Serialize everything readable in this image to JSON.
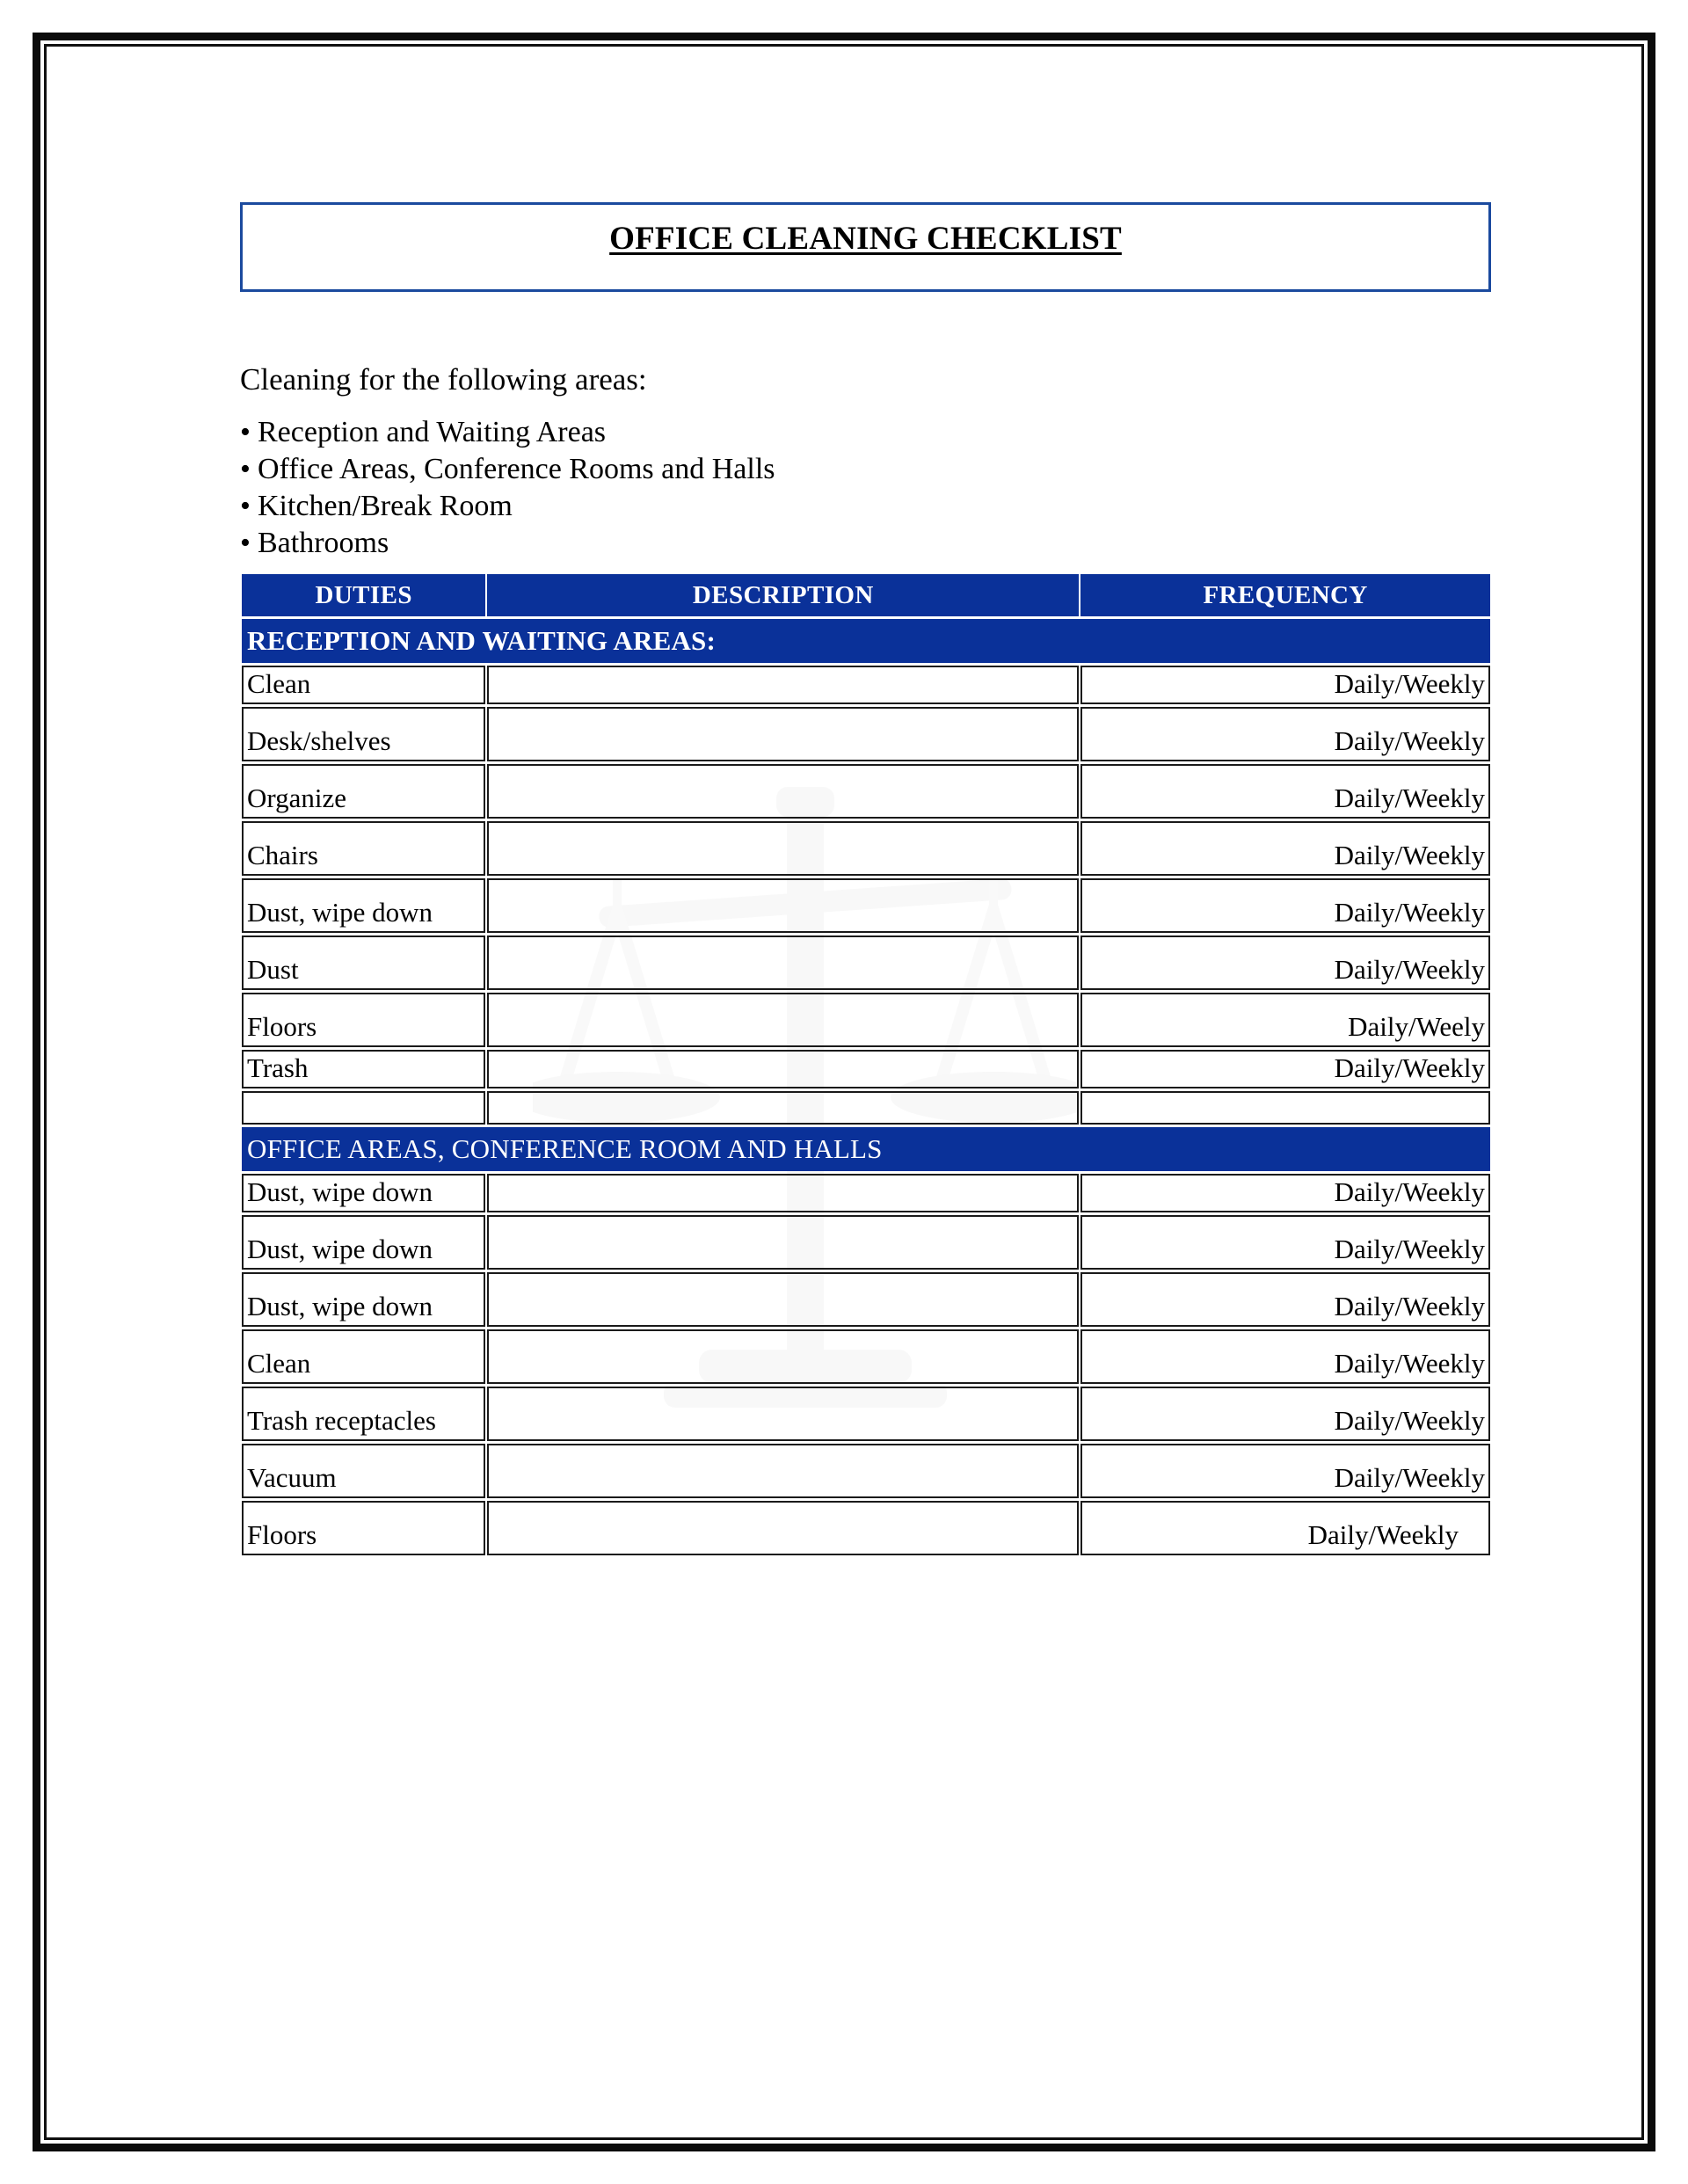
{
  "document": {
    "title": "OFFICE CLEANING CHECKLIST",
    "intro_lead": "Cleaning for the following areas:",
    "areas": [
      "Reception and Waiting Areas",
      "Office Areas, Conference Rooms and Halls",
      "Kitchen/Break Room",
      "Bathrooms"
    ],
    "bullet_glyph": "•",
    "watermark": "scales-of-justice-watermark"
  },
  "colors": {
    "header_blue": "#0a3199",
    "title_border_blue": "#1b4a9e",
    "page_border_black": "#0b0b0b",
    "header_text": "#ffffff",
    "body_text": "#000000"
  },
  "table": {
    "columns": [
      "DUTIES",
      "DESCRIPTION",
      "FREQUENCY"
    ],
    "sections": [
      {
        "banner": "RECEPTION AND WAITING AREAS:",
        "banner_bold": true,
        "rows": [
          {
            "duty": "Clean",
            "description": "",
            "frequency": "Daily/Weekly",
            "height": "short"
          },
          {
            "duty": "Desk/shelves",
            "description": "",
            "frequency": "Daily/Weekly",
            "height": "tall"
          },
          {
            "duty": "Organize",
            "description": "",
            "frequency": "Daily/Weekly",
            "height": "tall"
          },
          {
            "duty": "Chairs",
            "description": "",
            "frequency": "Daily/Weekly",
            "height": "tall"
          },
          {
            "duty": "Dust, wipe down",
            "description": "",
            "frequency": "Daily/Weekly",
            "height": "tall"
          },
          {
            "duty": "Dust",
            "description": "",
            "frequency": "Daily/Weekly",
            "height": "tall"
          },
          {
            "duty": "Floors",
            "description": "",
            "frequency": "Daily/Weely",
            "height": "tall"
          },
          {
            "duty": "Trash",
            "description": "",
            "frequency": "Daily/Weekly",
            "height": "short"
          },
          {
            "duty": "",
            "description": "",
            "frequency": "",
            "height": "blank"
          }
        ]
      },
      {
        "banner": "OFFICE AREAS, CONFERENCE ROOM AND HALLS",
        "banner_bold": false,
        "rows": [
          {
            "duty": "Dust, wipe down",
            "description": "",
            "frequency": "Daily/Weekly",
            "height": "short"
          },
          {
            "duty": "Dust, wipe down",
            "description": "",
            "frequency": "Daily/Weekly",
            "height": "tall"
          },
          {
            "duty": "Dust, wipe down",
            "description": "",
            "frequency": "Daily/Weekly",
            "height": "tall"
          },
          {
            "duty": "Clean",
            "description": "",
            "frequency": "Daily/Weekly",
            "height": "tall"
          },
          {
            "duty": "Trash receptacles",
            "description": "",
            "frequency": "Daily/Weekly",
            "height": "tall"
          },
          {
            "duty": "Vacuum",
            "description": "",
            "frequency": "Daily/Weekly",
            "height": "tall"
          },
          {
            "duty": "Floors",
            "description": "",
            "frequency": "Daily/Weekly",
            "height": "tall",
            "freq_indent": true
          }
        ]
      }
    ]
  }
}
